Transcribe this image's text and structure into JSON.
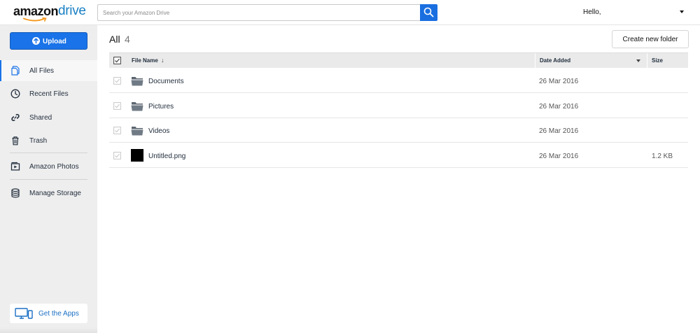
{
  "header": {
    "logo_word1": "amazon",
    "logo_word2": "drive",
    "search_placeholder": "Search your Amazon Drive",
    "greeting": "Hello,"
  },
  "sidebar": {
    "upload_label": "Upload",
    "items": [
      {
        "label": "All Files",
        "icon": "files-icon",
        "active": true
      },
      {
        "label": "Recent Files",
        "icon": "clock-icon",
        "active": false
      },
      {
        "label": "Shared",
        "icon": "link-icon",
        "active": false
      },
      {
        "label": "Trash",
        "icon": "trash-icon",
        "active": false
      },
      {
        "label": "Amazon Photos",
        "icon": "photos-icon",
        "active": false
      },
      {
        "label": "Manage Storage",
        "icon": "database-icon",
        "active": false
      }
    ],
    "get_apps_label": "Get the Apps"
  },
  "main": {
    "title": "All",
    "count": "4",
    "new_folder_label": "Create new folder",
    "columns": {
      "name": "File Name",
      "date": "Date Added",
      "size": "Size"
    },
    "rows": [
      {
        "name": "Documents",
        "type": "folder",
        "date": "26 Mar 2016",
        "size": ""
      },
      {
        "name": "Pictures",
        "type": "folder",
        "date": "26 Mar 2016",
        "size": ""
      },
      {
        "name": "Videos",
        "type": "folder",
        "date": "26 Mar 2016",
        "size": ""
      },
      {
        "name": "Untitled.png",
        "type": "image",
        "date": "26 Mar 2016",
        "size": "1.2 KB"
      }
    ]
  },
  "colors": {
    "accent": "#1a73e8",
    "logo_blue": "#1a80c4",
    "sidebar_bg": "#eeeeee",
    "header_row_bg": "#eaeaea"
  }
}
